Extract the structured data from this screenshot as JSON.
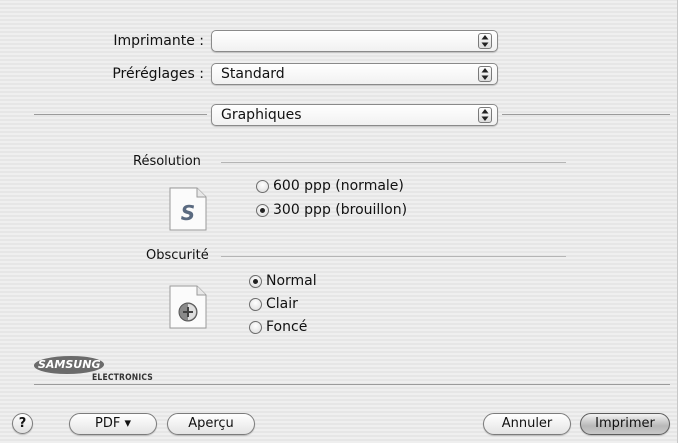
{
  "form": {
    "printer_label": "Imprimante :",
    "printer_value": "",
    "presets_label": "Préréglages :",
    "presets_value": "Standard",
    "panel_value": "Graphiques"
  },
  "resolution": {
    "label": "Résolution",
    "options": [
      {
        "label": "600 ppp (normale)",
        "selected": false
      },
      {
        "label": "300 ppp (brouillon)",
        "selected": true
      }
    ],
    "icon": "document-s-icon"
  },
  "darkness": {
    "label": "Obscurité",
    "options": [
      {
        "label": "Normal",
        "selected": true
      },
      {
        "label": "Clair",
        "selected": false
      },
      {
        "label": "Foncé",
        "selected": false
      }
    ],
    "icon": "document-darkness-icon"
  },
  "brand": {
    "name": "SAMSUNG",
    "sub": "ELECTRONICS"
  },
  "buttons": {
    "help": "?",
    "pdf": "PDF ▾",
    "preview": "Aperçu",
    "cancel": "Annuler",
    "print": "Imprimer"
  }
}
